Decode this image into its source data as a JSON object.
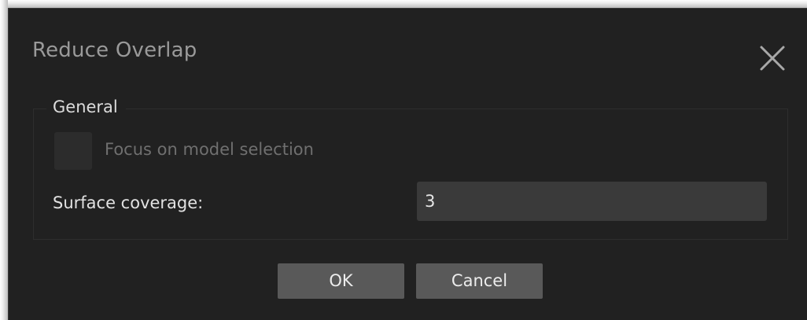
{
  "dialog": {
    "title": "Reduce Overlap",
    "close_icon": "close-icon"
  },
  "general_group": {
    "legend": "General",
    "focus_checkbox": {
      "label": "Focus on model selection",
      "checked": false,
      "disabled": true
    },
    "surface_coverage": {
      "label": "Surface coverage:",
      "value": "3"
    }
  },
  "buttons": {
    "ok_label": "OK",
    "cancel_label": "Cancel"
  },
  "colors": {
    "dialog_bg": "#212121",
    "input_bg": "#3a3a3a",
    "button_bg": "#595959",
    "title_text": "#9a9a9a",
    "disabled_text": "#6f6f6f"
  }
}
